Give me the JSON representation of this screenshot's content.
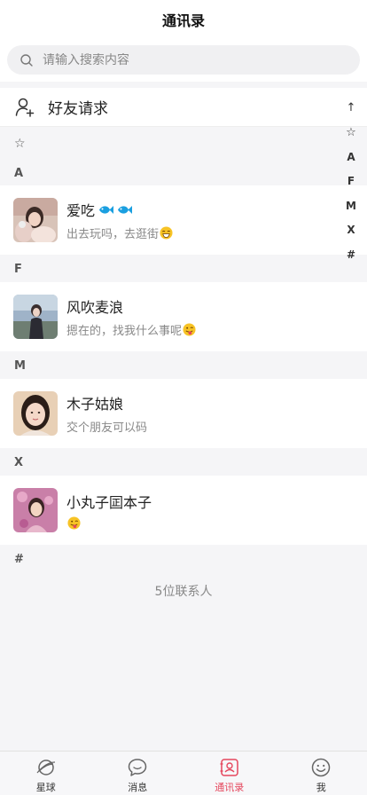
{
  "header": {
    "title": "通讯录"
  },
  "search": {
    "placeholder": "请输入搜索内容",
    "icon": "search-icon"
  },
  "friend_request": {
    "label": "好友请求",
    "icon": "add-user-icon"
  },
  "sections": [
    {
      "letter": "☆"
    },
    {
      "letter": "A"
    },
    {
      "letter": "F"
    },
    {
      "letter": "M"
    },
    {
      "letter": "X"
    },
    {
      "letter": "#"
    }
  ],
  "contacts": [
    {
      "name": "爱吃",
      "signature": "出去玩吗，去逛街",
      "badges": [
        "fish-icon",
        "fish-icon"
      ],
      "emoji": "grin-emoji"
    },
    {
      "name": "风吹麦浪",
      "signature": "摁在的，找我什么事呢",
      "emoji": "tongue-emoji"
    },
    {
      "name": "木子姑娘",
      "signature": "交个朋友可以码"
    },
    {
      "name": "小丸子囸本子",
      "signature": "",
      "emoji": "tongue-emoji"
    }
  ],
  "contact_count": "5位联系人",
  "index_bar": [
    "↑",
    "☆",
    "A",
    "F",
    "M",
    "X",
    "#"
  ],
  "tabs": [
    {
      "label": "星球",
      "icon": "planet-icon",
      "active": false
    },
    {
      "label": "消息",
      "icon": "chat-bubble-icon",
      "active": false
    },
    {
      "label": "通讯录",
      "icon": "contacts-icon",
      "active": true
    },
    {
      "label": "我",
      "icon": "smile-face-icon",
      "active": false
    }
  ],
  "colors": {
    "accent": "#e5475d",
    "fish_badge": "#1a9fe0",
    "background": "#f5f5f7"
  }
}
